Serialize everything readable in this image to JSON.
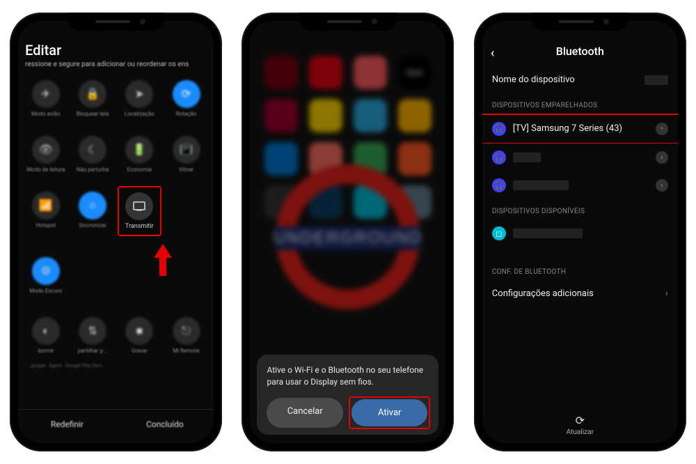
{
  "screen1": {
    "title": "Editar",
    "subtitle": "ressione e segure para adicionar ou reordenar os ens",
    "tiles_row1": [
      {
        "icon": "✈",
        "label": "Modo avião"
      },
      {
        "icon": "🔒",
        "label": "Bloquear tela"
      },
      {
        "icon": "➤",
        "label": "Localização"
      },
      {
        "icon": "⟳",
        "label": "Rotação",
        "active": true
      }
    ],
    "tiles_row2": [
      {
        "icon": "👁",
        "label": "Modo de leitura"
      },
      {
        "icon": "☾",
        "label": "Não perturbe"
      },
      {
        "icon": "🔋",
        "label": "Economia"
      },
      {
        "icon": "📳",
        "label": "Vibrar"
      }
    ],
    "tiles_row3": [
      {
        "icon": "📶",
        "label": "Hotspot"
      },
      {
        "icon": "○",
        "label": "Sincronizar",
        "active": true
      },
      {
        "icon": "▢",
        "label": "Transmitir",
        "highlight": true
      }
    ],
    "tiles_row4": [
      {
        "icon": "⚙",
        "label": "Modo Escuro",
        "active_blue": true
      }
    ],
    "tiles_row5": [
      {
        "icon": "◐",
        "label": "dormir"
      },
      {
        "icon": "⇅",
        "label": "partilhar p..."
      },
      {
        "icon": "■",
        "label": "Gravar"
      },
      {
        "icon": "⎋",
        "label": "Mi Remote"
      }
    ],
    "smalltext": "...google · Agent · Google Play Serv...",
    "footer_left": "Redefinir",
    "footer_right": "Concluído"
  },
  "screen2": {
    "message": "Ative o Wi-Fi e o Bluetooth no seu telefone para usar o Display sem fios.",
    "cancel": "Cancelar",
    "activate": "Ativar",
    "apps_colors": [
      "#7a0010",
      "#e30613",
      "#ff5a5f",
      "#000",
      "#a00030",
      "#ffd500",
      "#29a9e1",
      "#ffb400",
      "#0078d4",
      "#ff6f61",
      "#34a853",
      "#ff5722",
      "#333",
      "#0a3d62",
      "#00bcd4",
      "#607d8b"
    ]
  },
  "screen3": {
    "title": "Bluetooth",
    "device_name_label": "Nome do dispositivo",
    "paired_header": "DISPOSITIVOS EMPARELHADOS",
    "paired_main": "[TV] Samsung 7 Series (43)",
    "available_header": "DISPOSITIVOS DISPONÍVEIS",
    "conf_header": "CONF. DE BLUETOOTH",
    "more_settings": "Configurações adicionais",
    "refresh": "Atualizar"
  }
}
